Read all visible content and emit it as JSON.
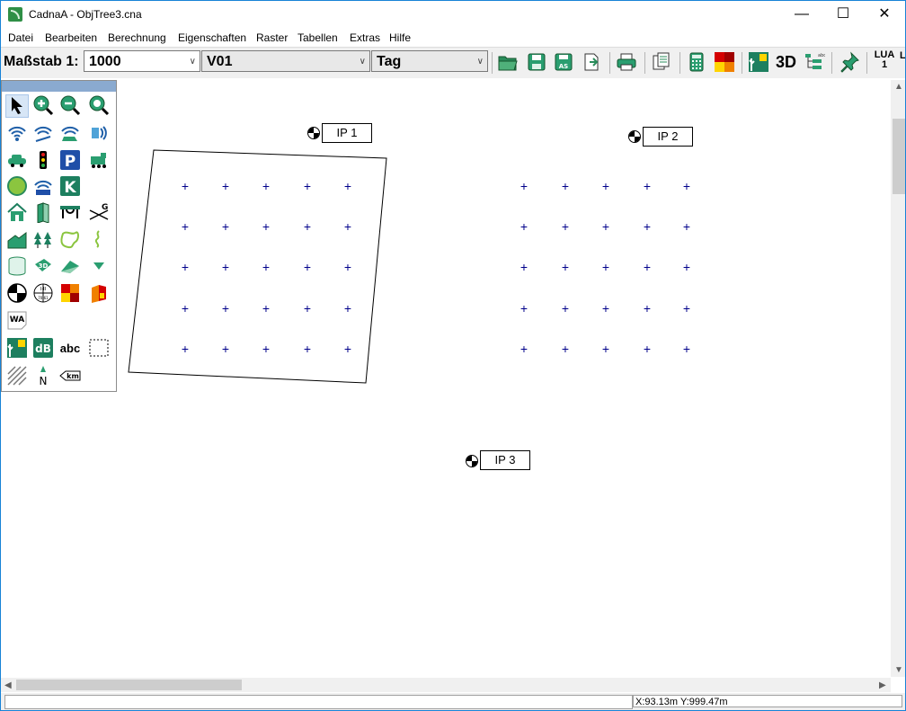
{
  "window": {
    "title": "CadnaA - ObjTree3.cna"
  },
  "menu": [
    "Datei",
    "Bearbeiten",
    "Berechnung",
    "Eigenschaften",
    "Raster",
    "Tabellen",
    "Extras",
    "Hilfe"
  ],
  "toolbar": {
    "scale_label": "Maßstab 1:",
    "scale_value": "1000",
    "variant_value": "V01",
    "period_value": "Tag",
    "btn_3d": "3D",
    "lua_label": "LUA",
    "lua_value": "1"
  },
  "canvas": {
    "points": [
      {
        "label": "IP 1"
      },
      {
        "label": "IP 2"
      },
      {
        "label": "IP 3"
      }
    ]
  },
  "palette": {
    "wa_label": "WA",
    "db_label": "dB",
    "abc_label": "abc",
    "km_label": "km",
    "north_label": "N"
  },
  "status": {
    "coords": "X:93.13m Y:999.47m"
  },
  "colors": {
    "accent": "#1883d7",
    "grid_point": "#00008b",
    "palette_title": "#8aaad0"
  }
}
